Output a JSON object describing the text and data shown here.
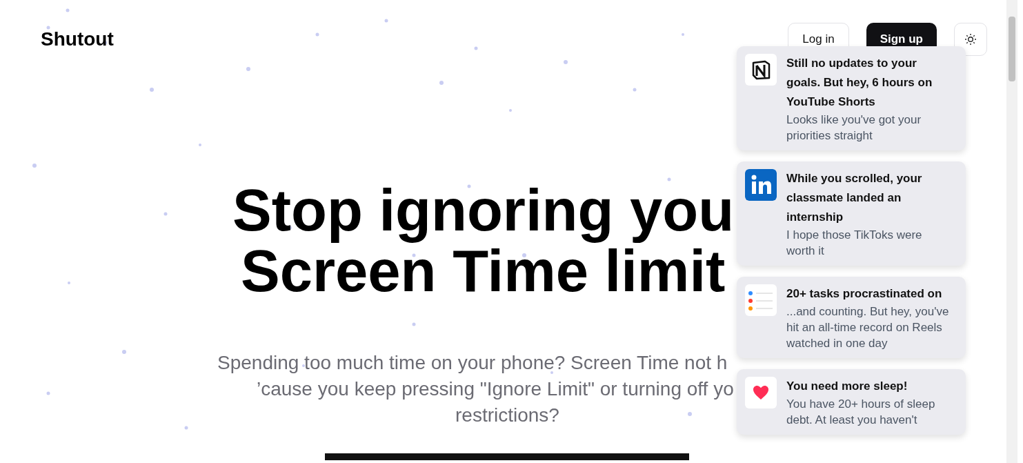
{
  "brand": "Shutout",
  "nav": {
    "buttons": [
      {
        "label": "Log in",
        "kind": "outline"
      },
      {
        "label": "Sign up",
        "kind": "solid"
      }
    ]
  },
  "hero": {
    "headline_lines": [
      "Stop ignoring you",
      "Screen Time limit"
    ],
    "subtitle_lines": [
      "Spending too much time on your phone? Screen Time not h",
      "’cause you keep pressing \"Ignore Limit\" or turning off yo",
      "restrictions?"
    ]
  },
  "notifications": [
    {
      "kind": "notion",
      "title": "Still no updates to your goals. But hey, 6 hours on YouTube Shorts",
      "body": "Looks like you've got your priorities straight"
    },
    {
      "kind": "linkedin",
      "title": "While you scrolled, your classmate landed an internship",
      "body": "I hope those TikToks were worth it"
    },
    {
      "kind": "reminders",
      "title": "20+ tasks procrastinated on",
      "body": "...and counting. But hey, you've hit an all-time record on Reels watched in one day"
    },
    {
      "kind": "health",
      "title": "You need more sleep!",
      "body": "You have 20+ hours of sleep debt. At least you haven't"
    }
  ]
}
